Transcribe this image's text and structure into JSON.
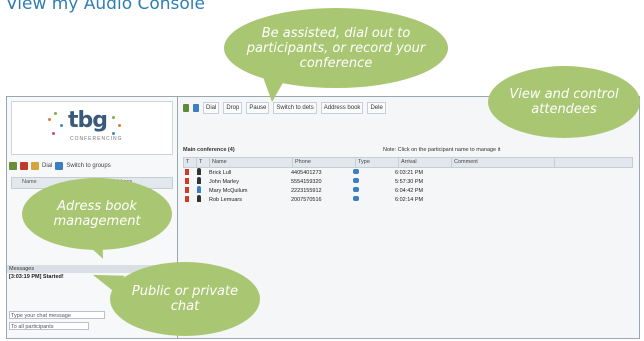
{
  "page_title": "View my Audio Console",
  "logo": {
    "text": "tbg",
    "sub": "CONFERENCING"
  },
  "left_toolbar": {
    "btn1": "Dial",
    "btn2": "Switch to groups"
  },
  "address_book": {
    "col_name": "Name",
    "col_address": "Address"
  },
  "messages": {
    "header": "Messages",
    "line": "[3:03:19 PM] Started!"
  },
  "chat": {
    "input_placeholder": "Type your chat message",
    "to": "To all participants"
  },
  "toolbar": {
    "dial": "Dial",
    "drop": "Drop",
    "pause": "Pause",
    "switch": "Switch to dets",
    "address_book": "Address book",
    "extra": "Dele"
  },
  "conference": {
    "title": "Main conference (4)",
    "note": "Note: Click on the participant name to manage it"
  },
  "grid": {
    "headers": [
      "T",
      "T",
      "Name",
      "Phone",
      "Type",
      "Arrival",
      "Comment"
    ],
    "rows": [
      {
        "name": "Brick Lull",
        "phone": "4405401273",
        "arrival": "6:03:21 PM"
      },
      {
        "name": "John Marley",
        "phone": "5554159320",
        "arrival": "5:57:30 PM"
      },
      {
        "name": "Mary McQuilum",
        "phone": "2223155912",
        "arrival": "6:04:42 PM"
      },
      {
        "name": "Rob Lemuars",
        "phone": "2007570516",
        "arrival": "6:02:14 PM"
      }
    ]
  },
  "callouts": {
    "top": "Be assisted, dial out to participants, or record your conference",
    "right": "View and control attendees",
    "left": "Adress book management",
    "bottom": "Public or private chat"
  },
  "colors": {
    "bubble": "#a9c772",
    "title": "#2f7fb5"
  }
}
